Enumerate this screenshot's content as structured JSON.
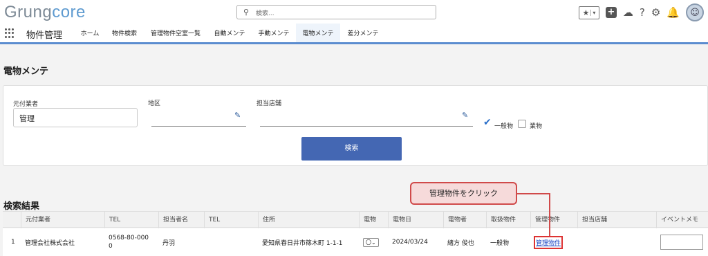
{
  "header": {
    "logo_prefix": "Grung",
    "logo_suffix": "core",
    "search_placeholder": "検索...",
    "icons": [
      "favorites-icon",
      "add-icon",
      "setup-assistant-icon",
      "help-icon",
      "gear-icon",
      "bell-icon",
      "avatar"
    ]
  },
  "nav": {
    "app_name": "物件管理",
    "tabs": [
      "ホーム",
      "物件検索",
      "管理物件空室一覧",
      "自動メンテ",
      "手動メンテ",
      "電物メンテ",
      "差分メンテ"
    ],
    "active_tab": "電物メンテ"
  },
  "page": {
    "title": "電物メンテ"
  },
  "search_form": {
    "motozuke_label": "元付業者",
    "motozuke_value": "管理",
    "chiku_label": "地区",
    "chiku_value": "",
    "tanto_label": "担当店舗",
    "tanto_value": "",
    "checkbox_ippan": "一般物",
    "checkbox_ippan_checked": true,
    "checkbox_gyo": "業物",
    "checkbox_gyo_checked": false,
    "search_button": "検索"
  },
  "results": {
    "title": "検索結果",
    "columns": [
      "",
      "元付業者",
      "TEL",
      "担当者名",
      "TEL",
      "住所",
      "電物",
      "電物日",
      "電物者",
      "取扱物件",
      "管理物件",
      "担当店舗",
      "イベントメモ"
    ],
    "rows": [
      {
        "index": "1",
        "motozuke": "管理会社株式会社",
        "tel1_line1": "0568-80-000",
        "tel1_line2": "0",
        "tanto": "丹羽",
        "tel2": "",
        "address": "愛知県春日井市篠木町 1-1-1",
        "denbutsu": "〇",
        "denbutsu_date": "2024/03/24",
        "denbutsu_person": "緒方 俊也",
        "toriatsukai": "一般物",
        "kanri_link": "管理物件",
        "tanto_store": "",
        "event_memo": ""
      }
    ]
  },
  "annotation": {
    "callout_text": "管理物件をクリック",
    "color": "#d04a4a"
  },
  "colors": {
    "brand_blue": "#4467b3",
    "nav_accent": "#5b8ccf",
    "link": "#1a44c4"
  }
}
